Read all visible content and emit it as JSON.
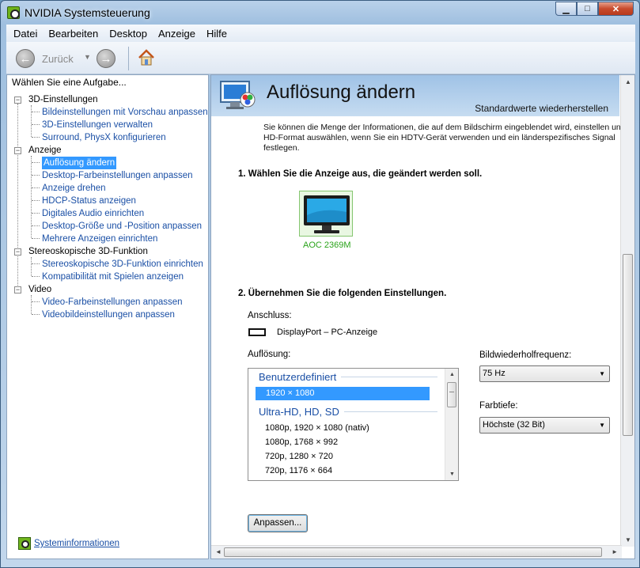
{
  "window": {
    "title": "NVIDIA Systemsteuerung"
  },
  "menu": [
    {
      "label": "Datei"
    },
    {
      "label": "Bearbeiten"
    },
    {
      "label": "Desktop"
    },
    {
      "label": "Anzeige"
    },
    {
      "label": "Hilfe"
    }
  ],
  "toolbar": {
    "back_label": "Zurück"
  },
  "sidebar": {
    "header": "Wählen Sie eine Aufgabe...",
    "tree": [
      {
        "label": "3D-Einstellungen",
        "children": [
          "Bildeinstellungen mit Vorschau anpassen",
          "3D-Einstellungen verwalten",
          "Surround, PhysX konfigurieren"
        ]
      },
      {
        "label": "Anzeige",
        "children": [
          "Auflösung ändern",
          "Desktop-Farbeinstellungen anpassen",
          "Anzeige drehen",
          "HDCP-Status anzeigen",
          "Digitales Audio einrichten",
          "Desktop-Größe und -Position anpassen",
          "Mehrere Anzeigen einrichten"
        ]
      },
      {
        "label": "Stereoskopische 3D-Funktion",
        "children": [
          "Stereoskopische 3D-Funktion einrichten",
          "Kompatibilität mit Spielen anzeigen"
        ]
      },
      {
        "label": "Video",
        "children": [
          "Video-Farbeinstellungen anpassen",
          "Videobildeinstellungen anpassen"
        ]
      }
    ],
    "selected": "Auflösung ändern",
    "system_info": "Systeminformationen"
  },
  "content": {
    "title": "Auflösung ändern",
    "restore_defaults": "Standardwerte wiederherstellen",
    "intro": "Sie können die Menge der Informationen, die auf dem Bildschirm eingeblendet wird, einstellen un\nHD-Format auswählen, wenn Sie ein HDTV-Gerät verwenden und ein länderspezifisches Signal\nfestlegen.",
    "step1": "1. Wählen Sie die Anzeige aus, die geändert werden soll.",
    "monitor_name": "AOC 2369M",
    "step2": "2. Übernehmen Sie die folgenden Einstellungen.",
    "connector_label": "Anschluss:",
    "connector_value": "DisplayPort – PC-Anzeige",
    "resolution_label": "Auflösung:",
    "resolution_list": {
      "groups": [
        {
          "name": "Benutzerdefiniert",
          "items": [
            "1920 × 1080"
          ]
        },
        {
          "name": "Ultra-HD, HD, SD",
          "items": [
            "1080p, 1920 × 1080 (nativ)",
            "1080p, 1768 × 992",
            "720p, 1280 × 720",
            "720p, 1176 × 664"
          ]
        }
      ],
      "selected": "1920 × 1080"
    },
    "refresh_label": "Bildwiederholfrequenz:",
    "refresh_value": "75 Hz",
    "depth_label": "Farbtiefe:",
    "depth_value": "Höchste (32 Bit)",
    "adjust_button": "Anpassen..."
  },
  "colors": {
    "link": "#1a4fa5",
    "selection": "#3399ff",
    "monitor_label": "#2aa31a",
    "banner": "#9fc2e6"
  }
}
